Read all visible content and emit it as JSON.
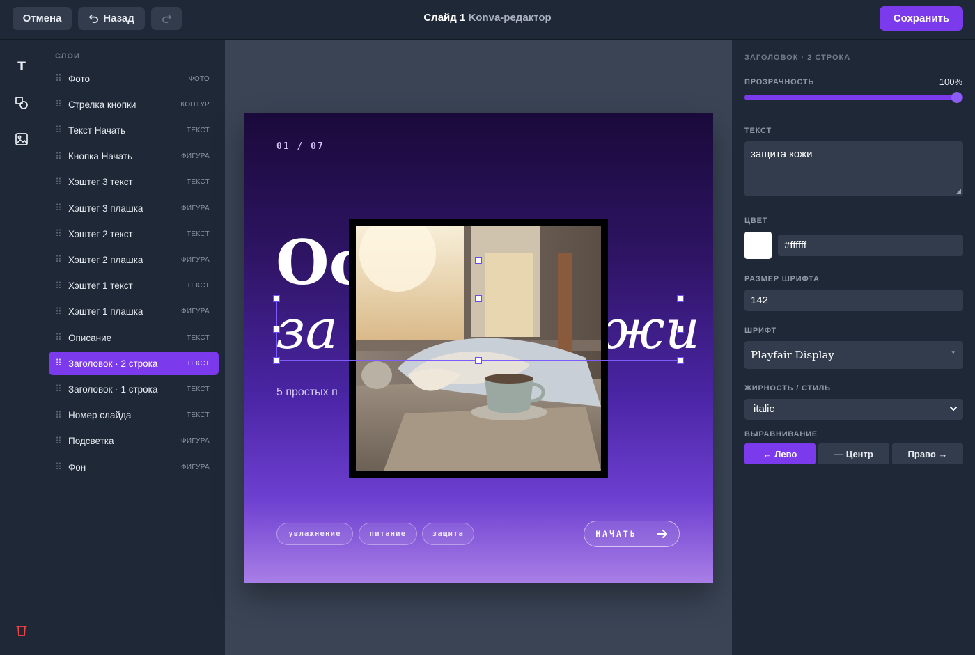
{
  "toolbar": {
    "cancel_label": "Отмена",
    "back_label": "Назад",
    "title_main": "Слайд 1",
    "title_sub": "Konva-редактор",
    "save_label": "Сохранить"
  },
  "tools": [
    {
      "name": "text-tool",
      "icon": "text-icon",
      "glyph": "T"
    },
    {
      "name": "shape-tool",
      "icon": "shapes-icon"
    },
    {
      "name": "image-tool",
      "icon": "image-icon"
    },
    {
      "name": "delete-tool",
      "icon": "trash-icon"
    }
  ],
  "layers": {
    "title": "СЛОИ",
    "items": [
      {
        "name": "Фото",
        "type": "ФОТО"
      },
      {
        "name": "Стрелка кнопки",
        "type": "КОНТУР"
      },
      {
        "name": "Текст Начать",
        "type": "ТЕКСТ"
      },
      {
        "name": "Кнопка Начать",
        "type": "ФИГУРА"
      },
      {
        "name": "Хэштег 3 текст",
        "type": "ТЕКСТ"
      },
      {
        "name": "Хэштег 3 плашка",
        "type": "ФИГУРА"
      },
      {
        "name": "Хэштег 2 текст",
        "type": "ТЕКСТ"
      },
      {
        "name": "Хэштег 2 плашка",
        "type": "ФИГУРА"
      },
      {
        "name": "Хэштег 1 текст",
        "type": "ТЕКСТ"
      },
      {
        "name": "Хэштег 1 плашка",
        "type": "ФИГУРА"
      },
      {
        "name": "Описание",
        "type": "ТЕКСТ"
      },
      {
        "name": "Заголовок · 2 строка",
        "type": "ТЕКСТ",
        "active": true
      },
      {
        "name": "Заголовок · 1 строка",
        "type": "ТЕКСТ"
      },
      {
        "name": "Номер слайда",
        "type": "ТЕКСТ"
      },
      {
        "name": "Подсветка",
        "type": "ФИГУРА"
      },
      {
        "name": "Фон",
        "type": "ФИГУРА"
      }
    ]
  },
  "slide": {
    "number": "01 / 07",
    "heading_line1_visible": "Ос",
    "heading_line2_left_visible": "за",
    "heading_line2_right_visible": "жи",
    "description_visible": "5 простых п",
    "tags": [
      "увлажнение",
      "питание",
      "защита"
    ],
    "cta_label": "НАЧАТЬ",
    "cta_icon": "arrow-right-icon"
  },
  "properties": {
    "section_title": "ЗАГОЛОВОК · 2 СТРОКА",
    "opacity_label": "ПРОЗРАЧНОСТЬ",
    "opacity_value": "100%",
    "opacity_fraction": 1.0,
    "text_label": "ТЕКСТ",
    "text_value": "защита кожи",
    "color_label": "ЦВЕТ",
    "color_value": "#ffffff",
    "font_size_label": "РАЗМЕР ШРИФТА",
    "font_size_value": "142",
    "font_label": "ШРИФТ",
    "font_value": "Playfair Display",
    "style_label": "ЖИРНОСТЬ / СТИЛЬ",
    "style_value": "italic",
    "align_label": "ВЫРАВНИВАНИЕ",
    "align_buttons": [
      {
        "label": "← Лево",
        "active": true
      },
      {
        "label": "— Центр",
        "active": false
      },
      {
        "label": "Право →",
        "active": false
      }
    ]
  },
  "colors": {
    "accent": "#7c3aed",
    "panel_bg": "#1f2837",
    "canvas_bg": "#3a4455",
    "input_bg": "#323c4c",
    "delete_red": "#ef4444"
  }
}
